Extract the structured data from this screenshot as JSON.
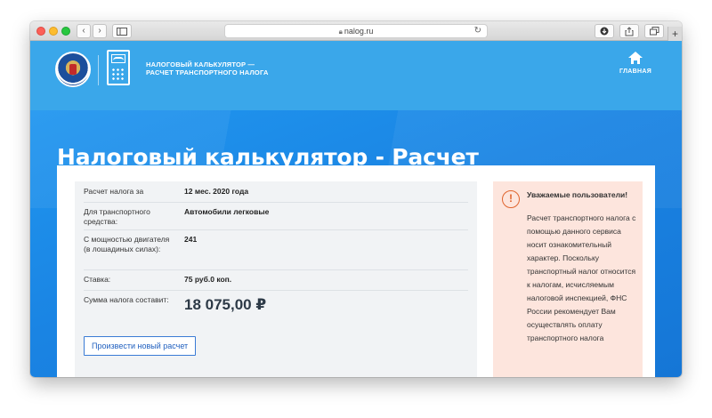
{
  "browser": {
    "url": "nalog.ru",
    "back_glyph": "‹",
    "forward_glyph": "›",
    "sidebar_icon": "sidebar-icon",
    "reload_glyph": "↻",
    "plus_glyph": "+"
  },
  "header": {
    "title_line1": "НАЛОГОВЫЙ КАЛЬКУЛЯТОР —",
    "title_line2": "РАСЧЕТ ТРАНСПОРТНОГО НАЛОГА",
    "home_label": "ГЛАВНАЯ"
  },
  "page": {
    "title": "Налоговый калькулятор - Расчет транспортного налога"
  },
  "result": {
    "rows": [
      {
        "label": "Расчет налога за",
        "value": "12 мес. 2020 года"
      },
      {
        "label": "Для транспортного средства:",
        "value": "Автомобили легковые"
      },
      {
        "label": "С мощностью двигателя (в лошадиных силах):",
        "value": "241"
      },
      {
        "label": "Ставка:",
        "value": "75 руб.0 коп."
      },
      {
        "label": "Сумма налога составит:",
        "value": "18 075,00 ₽"
      }
    ],
    "new_calc_button": "Произвести новый расчет"
  },
  "notice": {
    "icon_glyph": "!",
    "title": "Уважаемые пользователи!",
    "body": "Расчет транспортного налога с помощью данного сервиса носит ознакомительный характер. Поскольку транспортный налог относится к налогам, исчисляемым налоговой инспекцией, ФНС России рекомендует Вам осуществлять оплату транспортного налога"
  },
  "colors": {
    "header_bg": "#3aa7ea",
    "hero_bg": "#1a84e3",
    "notice_bg": "#fde5dd",
    "warning_accent": "#e0652f",
    "button_border": "#3a7bd5"
  }
}
